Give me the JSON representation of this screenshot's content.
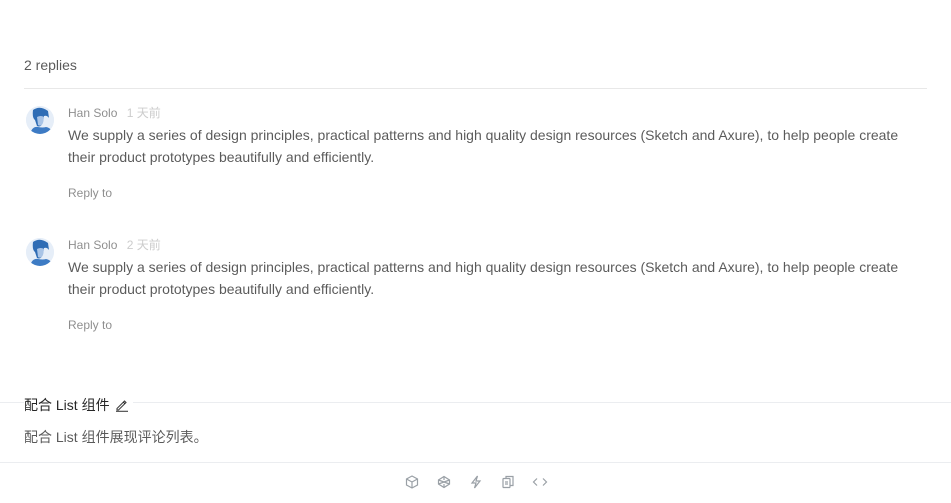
{
  "list": {
    "header": "2 replies",
    "comments": [
      {
        "author": "Han Solo",
        "time": "1 天前",
        "content": "We supply a series of design principles, practical patterns and high quality design resources (Sketch and Axure), to help people create their product prototypes beautifully and efficiently.",
        "reply_label": "Reply to"
      },
      {
        "author": "Han Solo",
        "time": "2 天前",
        "content": "We supply a series of design principles, practical patterns and high quality design resources (Sketch and Axure), to help people create their product prototypes beautifully and efficiently.",
        "reply_label": "Reply to"
      }
    ]
  },
  "demo": {
    "title": "配合 List 组件",
    "description": "配合 List 组件展现评论列表。",
    "edit_icon": "edit-icon"
  },
  "actions": {
    "icons": [
      "codesandbox-icon",
      "codepen-icon",
      "lightning-icon",
      "copy-icon",
      "code-icon"
    ]
  },
  "colors": {
    "divider": "#e8e8e8",
    "muted": "#cccccc",
    "icon": "#9aa0a6"
  }
}
